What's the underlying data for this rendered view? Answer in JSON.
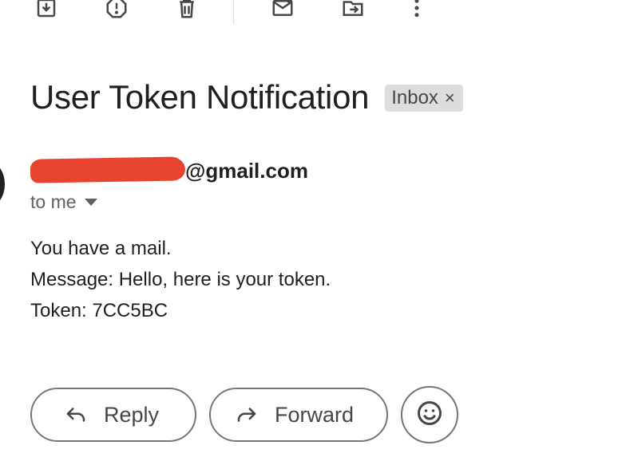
{
  "toolbar": {
    "icons": [
      "archive-icon",
      "report-spam-icon",
      "delete-icon",
      "mark-unread-icon",
      "move-to-icon",
      "more-options-icon"
    ]
  },
  "email": {
    "subject": "User Token Notification",
    "label": "Inbox",
    "label_remove": "×",
    "sender_visible": "@gmail.com",
    "recipient": "to me",
    "body": [
      "You have a mail.",
      "Message: Hello, here is your token.",
      "Token: 7CC5BC"
    ]
  },
  "actions": {
    "reply_label": "Reply",
    "forward_label": "Forward"
  },
  "colors": {
    "redaction": "#e8432e",
    "chip_bg": "#dddddd",
    "text": "#1f1f1f",
    "secondary_text": "#5f6368",
    "icon": "#444746"
  }
}
